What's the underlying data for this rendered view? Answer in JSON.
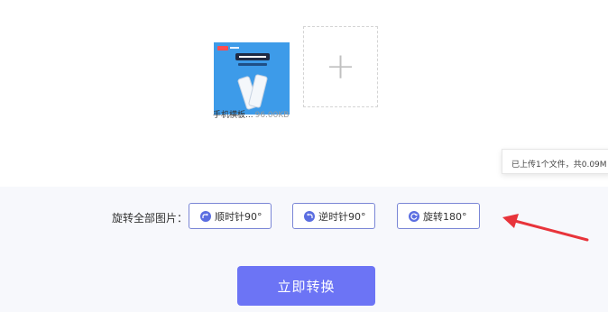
{
  "files": [
    {
      "name": "手机横板...",
      "size": "96.00KB"
    }
  ],
  "add_button": {
    "glyph": "+"
  },
  "tooltip": {
    "text": "已上传1个文件，共0.09M"
  },
  "rotate": {
    "label": "旋转全部图片：",
    "buttons": [
      {
        "label": "顺时针90°",
        "icon": "rotate-cw-icon"
      },
      {
        "label": "逆时针90°",
        "icon": "rotate-ccw-icon"
      },
      {
        "label": "旋转180°",
        "icon": "rotate-180-icon"
      }
    ]
  },
  "convert_button": {
    "label": "立即转换"
  },
  "colors": {
    "accent": "#6c74f5",
    "icon": "#5b6ee1",
    "annotation_arrow": "#e8343b",
    "thumb_bg": "#3d9be9"
  }
}
